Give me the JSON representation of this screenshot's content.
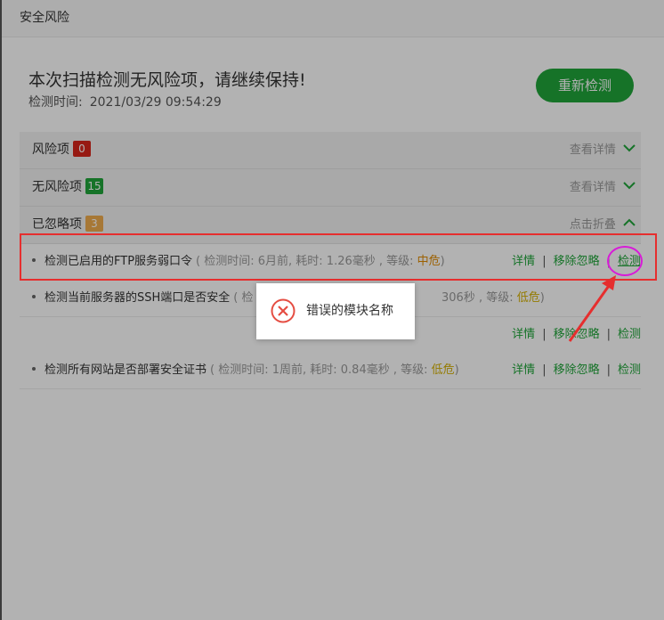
{
  "dialog": {
    "title": "安全风险"
  },
  "summary": {
    "title": "本次扫描检测无风险项，请继续保持!",
    "time_label": "检测时间:",
    "time_value": "2021/03/29 09:54:29",
    "recheck_label": "重新检测"
  },
  "groups": [
    {
      "label": "风险项",
      "count": "0",
      "toggle": "查看详情"
    },
    {
      "label": "无风险项",
      "count": "15",
      "toggle": "查看详情"
    },
    {
      "label": "已忽略项",
      "count": "3",
      "toggle": "点击折叠"
    }
  ],
  "ignored_items": [
    {
      "name": "检测已启用的FTP服务弱口令",
      "meta_prefix": "( 检测时间: 6月前, 耗时: 1.26毫秒 , 等级: ",
      "level": "中危",
      "meta_suffix": ")",
      "actions": [
        "详情",
        "移除忽略",
        "检测"
      ]
    },
    {
      "name": "检测当前服务器的SSH端口是否安全",
      "meta_prefix": "( 检",
      "meta_tail": "306秒 , 等级: ",
      "level": "低危",
      "meta_suffix": ")"
    },
    {
      "actions": [
        "详情",
        "移除忽略",
        "检测"
      ]
    },
    {
      "name": "检测所有网站是否部署安全证书",
      "meta_prefix": "( 检测时间: 1周前, 耗时: 0.84毫秒 , 等级: ",
      "level": "低危",
      "meta_suffix": ")",
      "actions": [
        "详情",
        "移除忽略",
        "检测"
      ]
    }
  ],
  "toast": {
    "message": "错误的模块名称",
    "icon": "error-circle-icon"
  },
  "colors": {
    "accent": "#20a53a",
    "danger": "#d9261c",
    "warning": "#f0ad4e",
    "mid_level": "#e08a00",
    "low_level": "#d4b000"
  }
}
